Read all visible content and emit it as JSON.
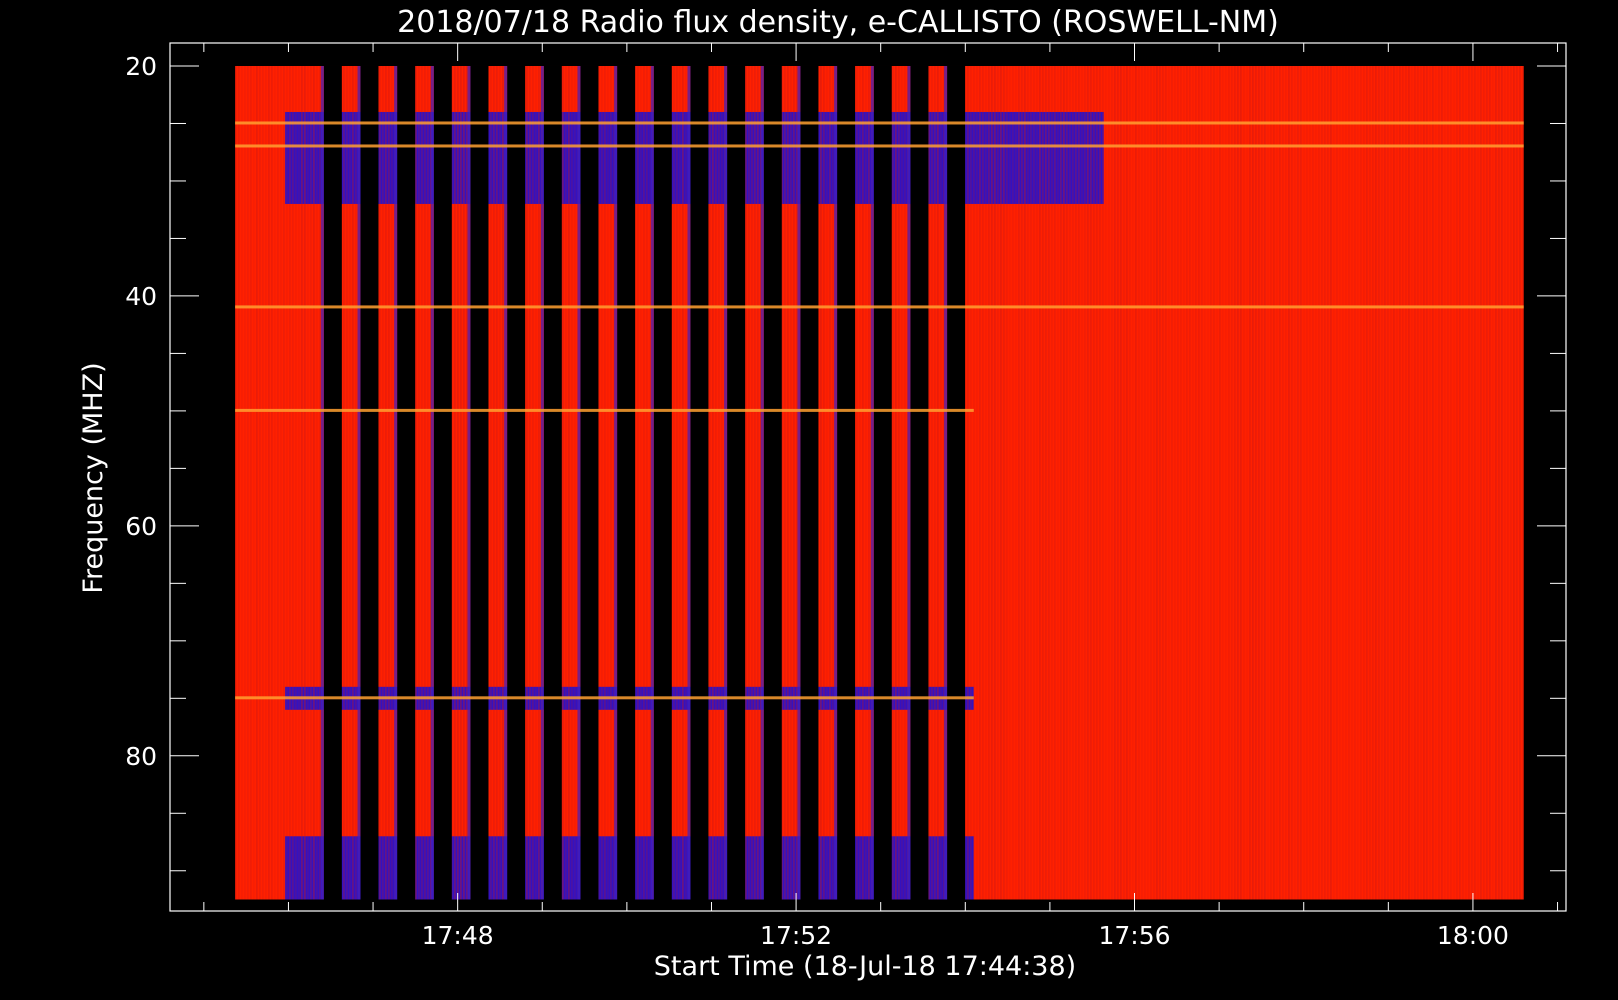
{
  "chart_data": {
    "type": "heatmap",
    "title": "2018/07/18  Radio flux density, e-CALLISTO (ROSWELL-NM)",
    "xlabel": "Start Time (18-Jul-18 17:44:38)",
    "ylabel": "Frequency (MHZ)",
    "x_axis": {
      "ticks": [
        "17:48",
        "17:52",
        "17:56",
        "18:00"
      ],
      "tick_minutes": [
        228,
        232,
        236,
        240
      ],
      "range_minutes": [
        224.6,
        241.1
      ],
      "unit": "minutes after 14:00"
    },
    "y_axis": {
      "ticks": [
        "20",
        "40",
        "60",
        "80"
      ],
      "tick_values": [
        20,
        40,
        60,
        80
      ],
      "range": [
        18,
        93.5
      ],
      "inverted": true
    },
    "data_extent": {
      "x_minutes": [
        225.37,
        240.6
      ],
      "y_mhz": [
        20,
        92.5
      ]
    },
    "colors": {
      "background": "#000000",
      "high": "#ff2000",
      "mid": "#c81818",
      "low": "#1010e0",
      "band": "#ffa030"
    },
    "gap_period_minutes": [
      226.3,
      234.1
    ],
    "band_lines_mhz": [
      25,
      27,
      41,
      50,
      75
    ],
    "low_bands_mhz": [
      [
        24,
        32
      ],
      [
        74,
        76
      ],
      [
        87,
        92.5
      ]
    ],
    "grid": false
  }
}
